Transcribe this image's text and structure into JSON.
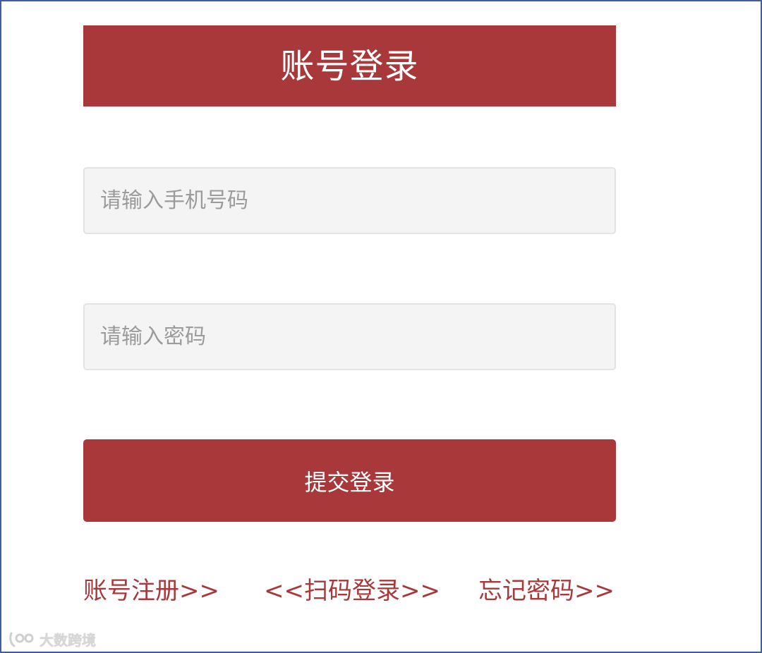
{
  "header": {
    "title": "账号登录"
  },
  "form": {
    "phone_placeholder": "请输入手机号码",
    "password_placeholder": "请输入密码",
    "submit_label": "提交登录"
  },
  "links": {
    "register": "账号注册>>",
    "scan_login": "<<扫码登录>>",
    "forgot_password": "忘记密码>>"
  },
  "watermark": {
    "text": "大数跨境"
  },
  "colors": {
    "accent": "#a8383a",
    "field_bg": "#f4f4f4",
    "frame_border": "#3f5f9a"
  }
}
